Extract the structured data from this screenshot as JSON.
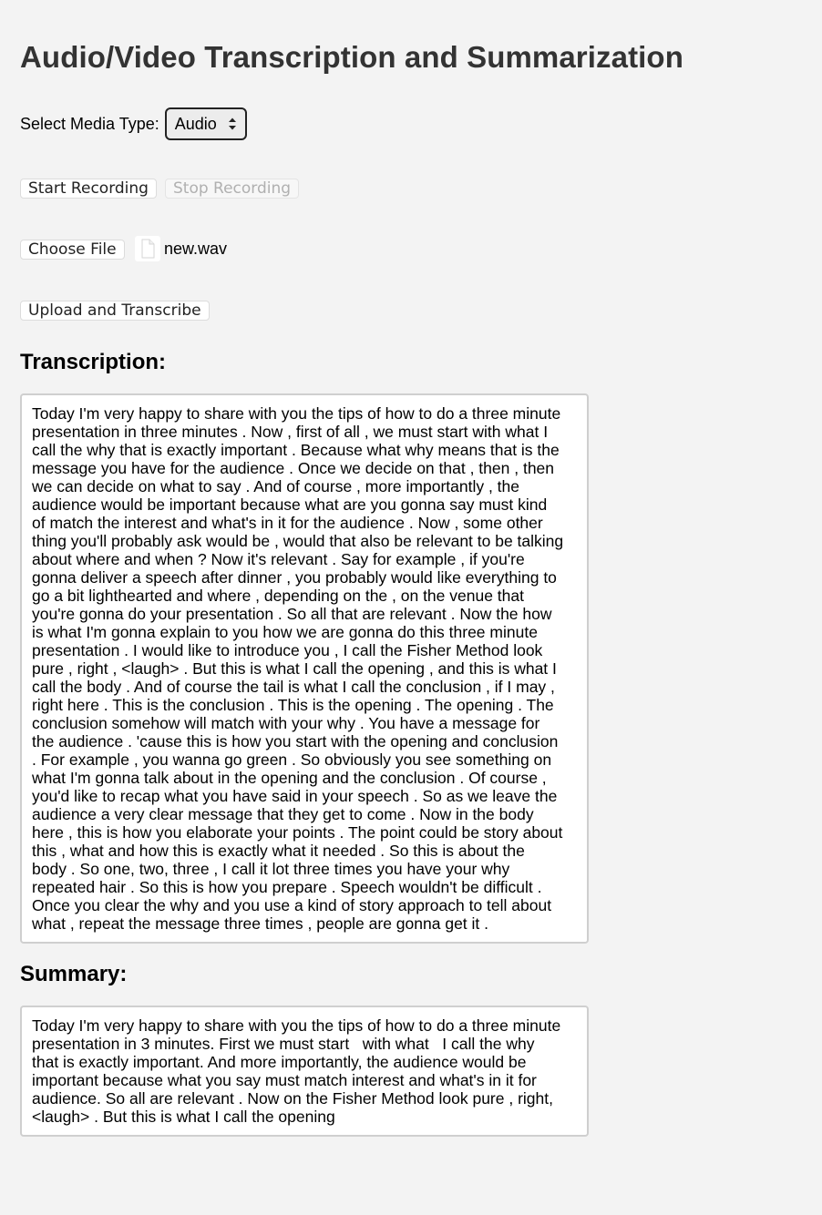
{
  "page": {
    "title": "Audio/Video Transcription and Summarization"
  },
  "media_type": {
    "label": "Select Media Type:",
    "selected": "Audio"
  },
  "recording": {
    "start_label": "Start Recording",
    "stop_label": "Stop Recording"
  },
  "file_input": {
    "button_label": "Choose File",
    "file_name": "new.wav",
    "icon": "file-icon"
  },
  "upload": {
    "button_label": "Upload and Transcribe"
  },
  "transcription": {
    "heading": "Transcription:",
    "text": "Today I'm very happy to share with you the tips of how to do a three minute\npresentation in three minutes . Now , first of all , we must start with what I\ncall the why that is exactly important . Because what why means that is the\nmessage you have for the audience . Once we decide on that , then , then\nwe can decide on what to say . And of course , more importantly , the\naudience would be important because what are you gonna say must kind\nof match the interest and what's in it for the audience . Now , some other\nthing you'll probably ask would be , would that also be relevant to be talking\nabout where and when ? Now it's relevant . Say for example , if you're\ngonna deliver a speech after dinner , you probably would like everything to\ngo a bit lighthearted and where , depending on the , on the venue that\nyou're gonna do your presentation . So all that are relevant . Now the how\nis what I'm gonna explain to you how we are gonna do this three minute\npresentation . I would like to introduce you , I call the Fisher Method look\npure , right , <laugh> . But this is what I call the opening , and this is what I\ncall the body . And of course the tail is what I call the conclusion , if I may ,\nright here . This is the conclusion . This is the opening . The opening . The\nconclusion somehow will match with your why . You have a message for\nthe audience . 'cause this is how you start with the opening and conclusion\n. For example , you wanna go green . So obviously you see something on\nwhat I'm gonna talk about in the opening and the conclusion . Of course ,\nyou'd like to recap what you have said in your speech . So as we leave the\naudience a very clear message that they get to come . Now in the body\nhere , this is how you elaborate your points . The point could be story about\nthis , what and how this is exactly what it needed . So this is about the\nbody . So one, two, three , I call it lot three times you have your why\nrepeated hair . So this is how you prepare . Speech wouldn't be difficult .\nOnce you clear the why and you use a kind of story approach to tell about\nwhat , repeat the message three times , people are gonna get it ."
  },
  "summary": {
    "heading": "Summary:",
    "text": "Today I'm very happy to share with you the tips of how to do a three minute\npresentation in 3 minutes. First we must start   with what   I call the why\nthat is exactly important. And more importantly, the audience would be\nimportant because what you say must match interest and what's in it for\naudience. So all are relevant . Now on the Fisher Method look pure , right,\n<laugh> . But this is what I call the opening"
  },
  "colors": {
    "background": "#f3f3f3",
    "title_text": "#333333",
    "disabled_text": "#b0b0b0",
    "textbox_border": "#cfcfcf"
  }
}
